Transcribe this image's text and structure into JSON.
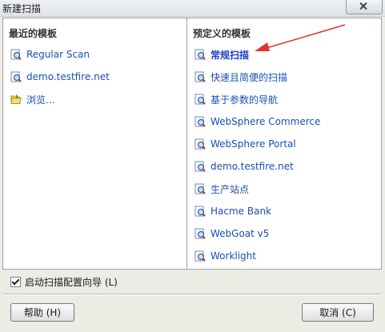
{
  "window": {
    "title": "新建扫描"
  },
  "recent": {
    "header": "最近的模板",
    "items": [
      {
        "label": "Regular Scan",
        "icon": "scan-template-icon"
      },
      {
        "label": "demo.testfire.net",
        "icon": "scan-template-icon"
      },
      {
        "label": "浏览...",
        "icon": "open-folder-icon"
      }
    ]
  },
  "predefined": {
    "header": "预定义的模板",
    "items": [
      {
        "label": "常规扫描",
        "icon": "scan-template-icon",
        "selected": true
      },
      {
        "label": "快速且简便的扫描",
        "icon": "scan-template-icon"
      },
      {
        "label": "基于参数的导航",
        "icon": "scan-template-icon"
      },
      {
        "label": "WebSphere Commerce",
        "icon": "scan-template-icon"
      },
      {
        "label": "WebSphere Portal",
        "icon": "scan-template-icon"
      },
      {
        "label": "demo.testfire.net",
        "icon": "scan-template-icon"
      },
      {
        "label": "生产站点",
        "icon": "scan-template-icon"
      },
      {
        "label": "Hacme Bank",
        "icon": "scan-template-icon"
      },
      {
        "label": "WebGoat v5",
        "icon": "scan-template-icon"
      },
      {
        "label": "Worklight",
        "icon": "scan-template-icon"
      }
    ]
  },
  "options": {
    "wizard_label": "启动扫描配置向导 (L)",
    "wizard_checked": true
  },
  "buttons": {
    "help": "帮助 (H)",
    "cancel": "取消 (C)"
  },
  "colors": {
    "link": "#1a4fb3",
    "annotation_arrow": "#e53030"
  }
}
